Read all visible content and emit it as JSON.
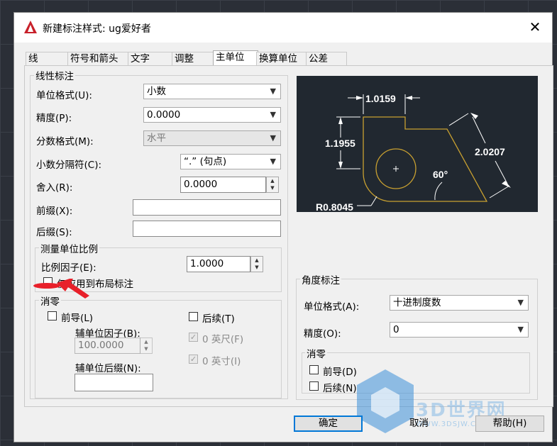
{
  "dialog": {
    "title": "新建标注样式: ug爱好者",
    "close_label": "✕"
  },
  "tabs": [
    "线",
    "符号和箭头",
    "文字",
    "调整",
    "主单位",
    "换算单位",
    "公差"
  ],
  "linear": {
    "group_title": "线性标注",
    "unit_format_label": "单位格式(U):",
    "unit_format_value": "小数",
    "precision_label": "精度(P):",
    "precision_value": "0.0000",
    "fraction_label": "分数格式(M):",
    "fraction_value": "水平",
    "decimal_sep_label": "小数分隔符(C):",
    "decimal_sep_value": "“.” (句点)",
    "roundoff_label": "舍入(R):",
    "roundoff_value": "0.0000",
    "prefix_label": "前缀(X):",
    "prefix_value": "",
    "suffix_label": "后缀(S):",
    "suffix_value": ""
  },
  "scale": {
    "group_title": "测量单位比例",
    "factor_label": "比例因子(E):",
    "factor_value": "1.0000",
    "layout_only_label": "仅应用到布局标注"
  },
  "zero_suppress": {
    "group_title": "消零",
    "leading_label": "前导(L)",
    "trailing_label": "后续(T)",
    "sub_factor_label": "辅单位因子(B):",
    "sub_factor_value": "100.0000",
    "sub_suffix_label": "辅单位后缀(N):",
    "sub_suffix_value": "",
    "feet_label": "0 英尺(F)",
    "inches_label": "0 英寸(I)"
  },
  "preview": {
    "dim_top": "1.0159",
    "dim_left": "1.1955",
    "dim_right": "2.0207",
    "angle": "60°",
    "radius": "R0.8045"
  },
  "angular": {
    "group_title": "角度标注",
    "unit_format_label": "单位格式(A):",
    "unit_format_value": "十进制度数",
    "precision_label": "精度(O):",
    "precision_value": "0",
    "zero_group_title": "消零",
    "leading_label": "前导(D)",
    "trailing_label": "后续(N)"
  },
  "buttons": {
    "ok": "确定",
    "cancel": "取消",
    "help": "帮助(H)"
  },
  "watermark": {
    "text": "3D世界网",
    "url": "WWW.3DSJW.COM"
  },
  "colors": {
    "preview_bg": "#212830",
    "geometry": "#c8a030",
    "accent": "#0078d7"
  }
}
